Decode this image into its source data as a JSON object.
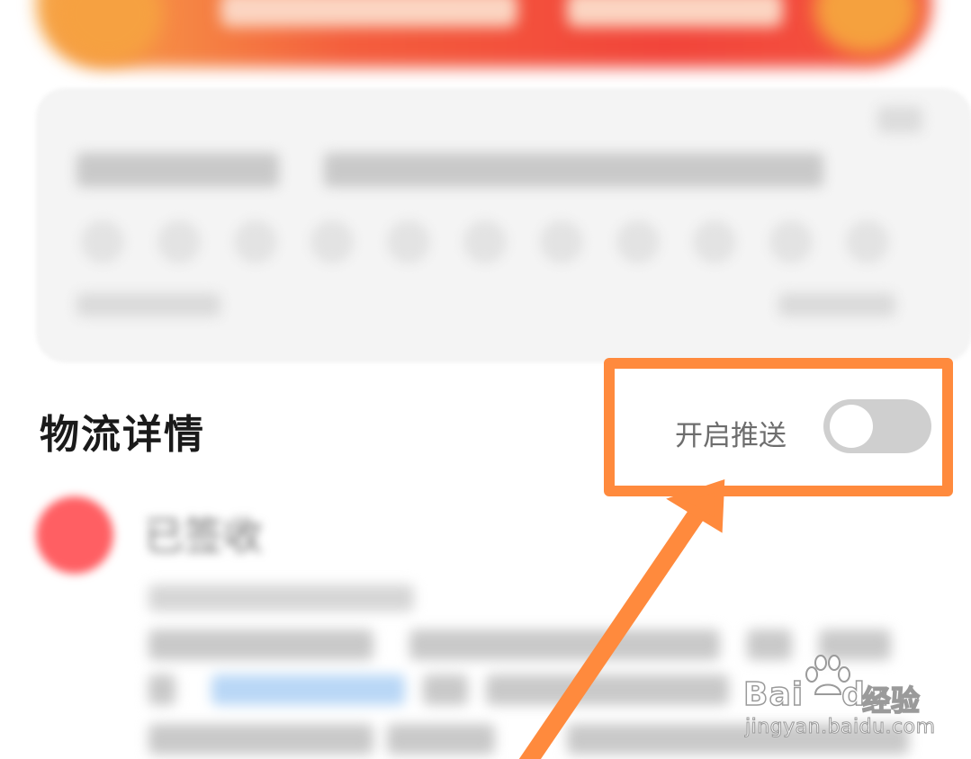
{
  "logistics": {
    "section_title": "物流详情",
    "push_label": "开启推送",
    "push_enabled": false,
    "latest_status": "已签收"
  },
  "colors": {
    "annotation": "#ff8a3d",
    "toggle_off": "#cfcfcf",
    "status_dot": "#ff5f63",
    "banner": "#f2453b"
  },
  "watermark": {
    "brand": "Bai",
    "brand_du": "du",
    "product": "经验",
    "url": "jingyan.baidu.com"
  }
}
